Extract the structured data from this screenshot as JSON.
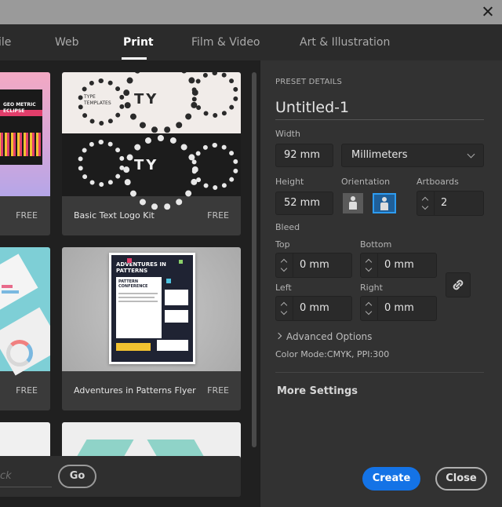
{
  "tabs": [
    {
      "label": "ile"
    },
    {
      "label": "Web"
    },
    {
      "label": "Print"
    },
    {
      "label": "Film & Video"
    },
    {
      "label": "Art & Illustration"
    }
  ],
  "templates": [
    {
      "title": "",
      "free": "FREE",
      "thumb_text": "GEO METRIC ECLIPSE"
    },
    {
      "title": "Basic Text Logo Kit",
      "free": "FREE",
      "thumb_text": "TYPE TEMPLATES"
    },
    {
      "title": "",
      "free": "FREE"
    },
    {
      "title": "Adventures in Patterns Flyer",
      "free": "FREE",
      "thumb_text": "ADVENTURES IN PATTERNS",
      "thumb_sub": "PATTERN CONFERENCE"
    }
  ],
  "search": {
    "text": "ck",
    "go_label": "Go"
  },
  "preset": {
    "section_label": "PRESET DETAILS",
    "name": "Untitled-1",
    "width_label": "Width",
    "width_value": "92 mm",
    "units_value": "Millimeters",
    "height_label": "Height",
    "height_value": "52 mm",
    "orientation_label": "Orientation",
    "artboards_label": "Artboards",
    "artboards_value": "2",
    "bleed_label": "Bleed",
    "top_label": "Top",
    "top_value": "0 mm",
    "bottom_label": "Bottom",
    "bottom_value": "0 mm",
    "left_label": "Left",
    "left_value": "0 mm",
    "right_label": "Right",
    "right_value": "0 mm",
    "advanced_label": "Advanced Options",
    "color_mode": "Color Mode:CMYK, PPI:300",
    "more_settings": "More Settings"
  },
  "actions": {
    "create": "Create",
    "close": "Close"
  },
  "colors": {
    "accent": "#1473e6",
    "orientation_selected": "#2d9bf0"
  }
}
